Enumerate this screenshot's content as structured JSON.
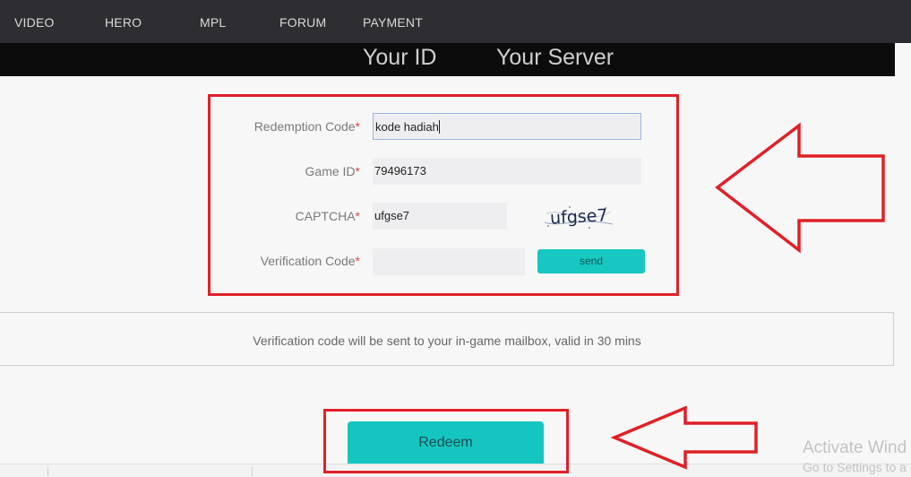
{
  "nav": {
    "items": [
      "VIDEO",
      "HERO",
      "MPL",
      "FORUM",
      "PAYMENT"
    ]
  },
  "hero": {
    "your_id": "Your ID",
    "your_server": "Your Server"
  },
  "form": {
    "redemption_code": {
      "label": "Redemption Code",
      "value": "kode hadiah"
    },
    "game_id": {
      "label": "Game ID",
      "value": "79496173"
    },
    "captcha": {
      "label": "CAPTCHA",
      "value": "ufgse7",
      "image_text": "ufgse7"
    },
    "verification_code": {
      "label": "Verification Code",
      "value": ""
    },
    "required_mark": "*",
    "send_label": "send"
  },
  "notice": "Verification code will be sent to your in-game mailbox, valid in 30 mins",
  "redeem_label": "Redeem",
  "watermark": {
    "line1": "Activate Wind",
    "line2": "Go to Settings to a"
  },
  "colors": {
    "accent": "#14c6bf",
    "annotation": "#e02027",
    "nav_bg": "#2e2e32",
    "required": "#e0474c"
  },
  "icons": [
    "left-arrow-annotation-icon",
    "left-arrow-annotation-icon"
  ]
}
